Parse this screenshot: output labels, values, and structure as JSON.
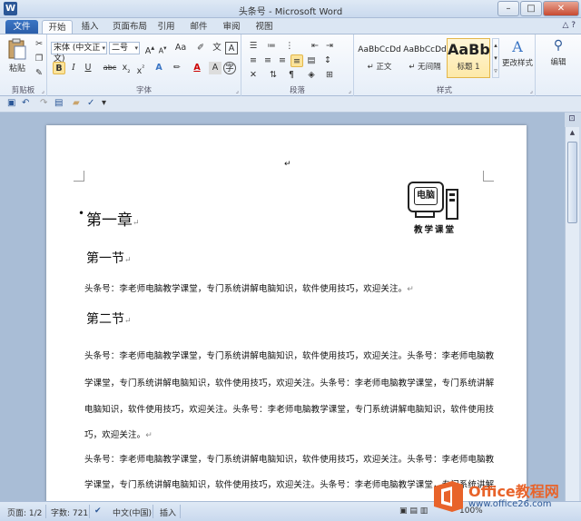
{
  "window": {
    "title": "头条号 - Microsoft Word",
    "app_icon": "W",
    "controls": [
      "–",
      "□",
      "✕"
    ]
  },
  "tabs": [
    {
      "label": "文件",
      "kind": "file"
    },
    {
      "label": "开始",
      "kind": "active"
    },
    {
      "label": "插入"
    },
    {
      "label": "页面布局"
    },
    {
      "label": "引用"
    },
    {
      "label": "邮件"
    },
    {
      "label": "审阅"
    },
    {
      "label": "视图"
    }
  ],
  "ribbon_controls": "△ ?",
  "ribbon": {
    "clipboard": {
      "paste": "粘贴",
      "label": "剪贴板"
    },
    "font": {
      "name": "宋体 (中文正文)",
      "size": "二号",
      "label": "字体"
    },
    "paragraph": {
      "label": "段落"
    },
    "styles": {
      "label": "样式",
      "items": [
        {
          "sample": "AaBbCcDd",
          "name": "↵ 正文"
        },
        {
          "sample": "AaBbCcDd",
          "name": "↵ 无间隔"
        },
        {
          "sample": "AaBb",
          "name": "标题 1",
          "selected": true
        }
      ],
      "change_styles": "更改样式"
    },
    "editing": {
      "label": "编辑"
    }
  },
  "document": {
    "logo_screen_text": "电脑",
    "logo_caption": "教学课堂",
    "heading1": "第一章",
    "section1": "第一节",
    "section2": "第二节",
    "para_mark": "↵",
    "para1": "头条号：李老师电脑教学课堂，专门系统讲解电脑知识，软件使用技巧，欢迎关注。",
    "para2_lines": [
      "头条号：李老师电脑教学课堂，专门系统讲解电脑知识，软件使用技巧，欢迎关注。头条号：李老师电脑教",
      "学课堂，专门系统讲解电脑知识，软件使用技巧，欢迎关注。头条号：李老师电脑教学课堂，专门系统讲解",
      "电脑知识，软件使用技巧，欢迎关注。头条号：李老师电脑教学课堂，专门系统讲解电脑知识，软件使用技",
      "巧，欢迎关注。"
    ],
    "para3_lines": [
      "头条号：李老师电脑教学课堂，专门系统讲解电脑知识，软件使用技巧，欢迎关注。头条号：李老师电脑教",
      "学课堂，专门系统讲解电脑知识，软件使用技巧，欢迎关注。头条号：李老师电脑教学课堂，专门系统讲解"
    ]
  },
  "status": {
    "page": "页面: 1/2",
    "words": "字数: 721",
    "language": "中文(中国)",
    "mode": "插入",
    "zoom": "100%"
  },
  "watermark": {
    "brand": "Office教程网",
    "url": "www.office26.com"
  }
}
